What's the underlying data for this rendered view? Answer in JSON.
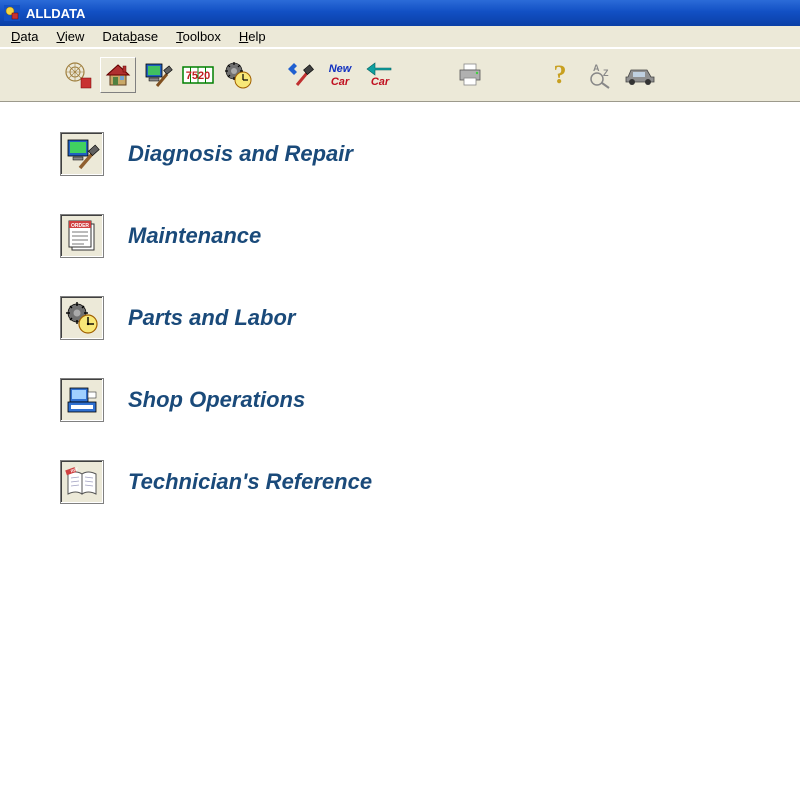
{
  "title": "ALLDATA",
  "menu": {
    "data": "Data",
    "view": "View",
    "database": "Database",
    "toolbox": "Toolbox",
    "help": "Help"
  },
  "toolbar": {
    "logo_icon": "alldata-logo-icon",
    "home_icon": "home-icon",
    "globe_icon": "globe-hammer-icon",
    "code_icon": "7520",
    "timer_icon": "gear-clock-icon",
    "hammer_icon": "hammer-sparks-icon",
    "newcar_label_top": "New",
    "newcar_label_bottom": "Car",
    "backcar_label": "Car",
    "print_icon": "printer-icon",
    "help_icon": "question-icon",
    "az_icon": "a-z-search-icon",
    "car_icon": "car-icon"
  },
  "main": {
    "items": [
      {
        "label": "Diagnosis and Repair",
        "icon": "monitor-hammer-icon"
      },
      {
        "label": "Maintenance",
        "icon": "order-sheet-icon"
      },
      {
        "label": "Parts and Labor",
        "icon": "gear-clock-icon"
      },
      {
        "label": "Shop Operations",
        "icon": "register-icon"
      },
      {
        "label": "Technician's Reference",
        "icon": "open-book-icon"
      }
    ]
  }
}
